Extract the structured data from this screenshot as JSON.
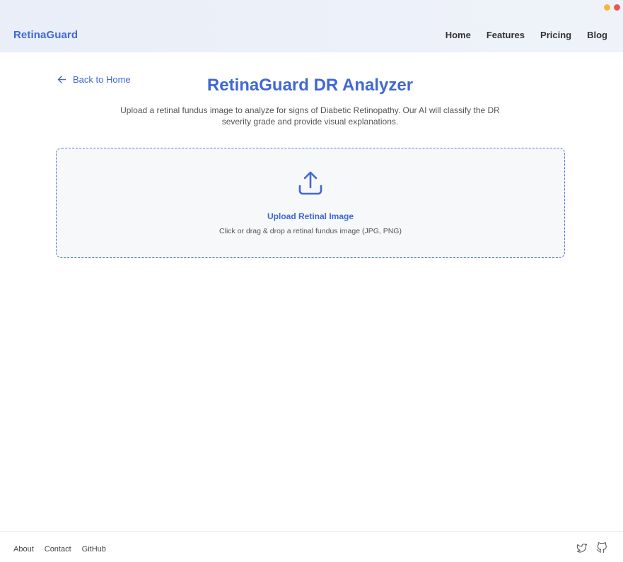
{
  "header": {
    "brand": "RetinaGuard",
    "nav": [
      "Home",
      "Features",
      "Pricing",
      "Blog"
    ]
  },
  "main": {
    "back_link": "Back to Home",
    "title": "RetinaGuard DR Analyzer",
    "subtitle": "Upload a retinal fundus image to analyze for signs of Diabetic Retinopathy. Our AI will classify the DR severity grade and provide visual explanations.",
    "upload": {
      "title": "Upload Retinal Image",
      "hint": "Click or drag & drop a retinal fundus image (JPG, PNG)",
      "icon": "upload-icon"
    }
  },
  "footer": {
    "links": [
      "About",
      "Contact",
      "GitHub"
    ],
    "social_icons": [
      "twitter-icon",
      "github-icon"
    ]
  },
  "colors": {
    "accent": "#3f67d6",
    "header_bg": "#edf1f9",
    "dropzone_bg": "#f7f8fa",
    "window_dot_yellow": "#f6b73c",
    "window_dot_red": "#ee5555"
  }
}
